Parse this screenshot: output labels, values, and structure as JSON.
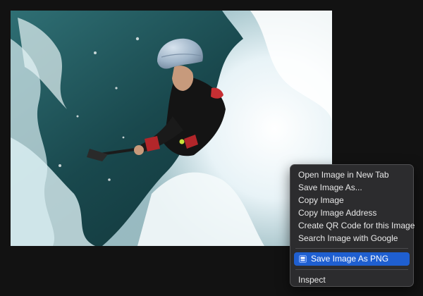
{
  "image": {
    "icon_name": "photo-whitewater-kayaker"
  },
  "context_menu": {
    "items": [
      {
        "label": "Open Image in New Tab"
      },
      {
        "label": "Save Image As..."
      },
      {
        "label": "Copy Image"
      },
      {
        "label": "Copy Image Address"
      },
      {
        "label": "Create QR Code for this Image"
      },
      {
        "label": "Search Image with Google"
      }
    ],
    "extension_item": {
      "label": "Save Image As PNG",
      "icon_name": "extension-icon",
      "highlight_color": "#1f5fd0"
    },
    "inspect_item": {
      "label": "Inspect"
    }
  },
  "colors": {
    "background": "#121212",
    "menu_background": "#2c2c2e",
    "menu_text": "#e8e8e8"
  }
}
